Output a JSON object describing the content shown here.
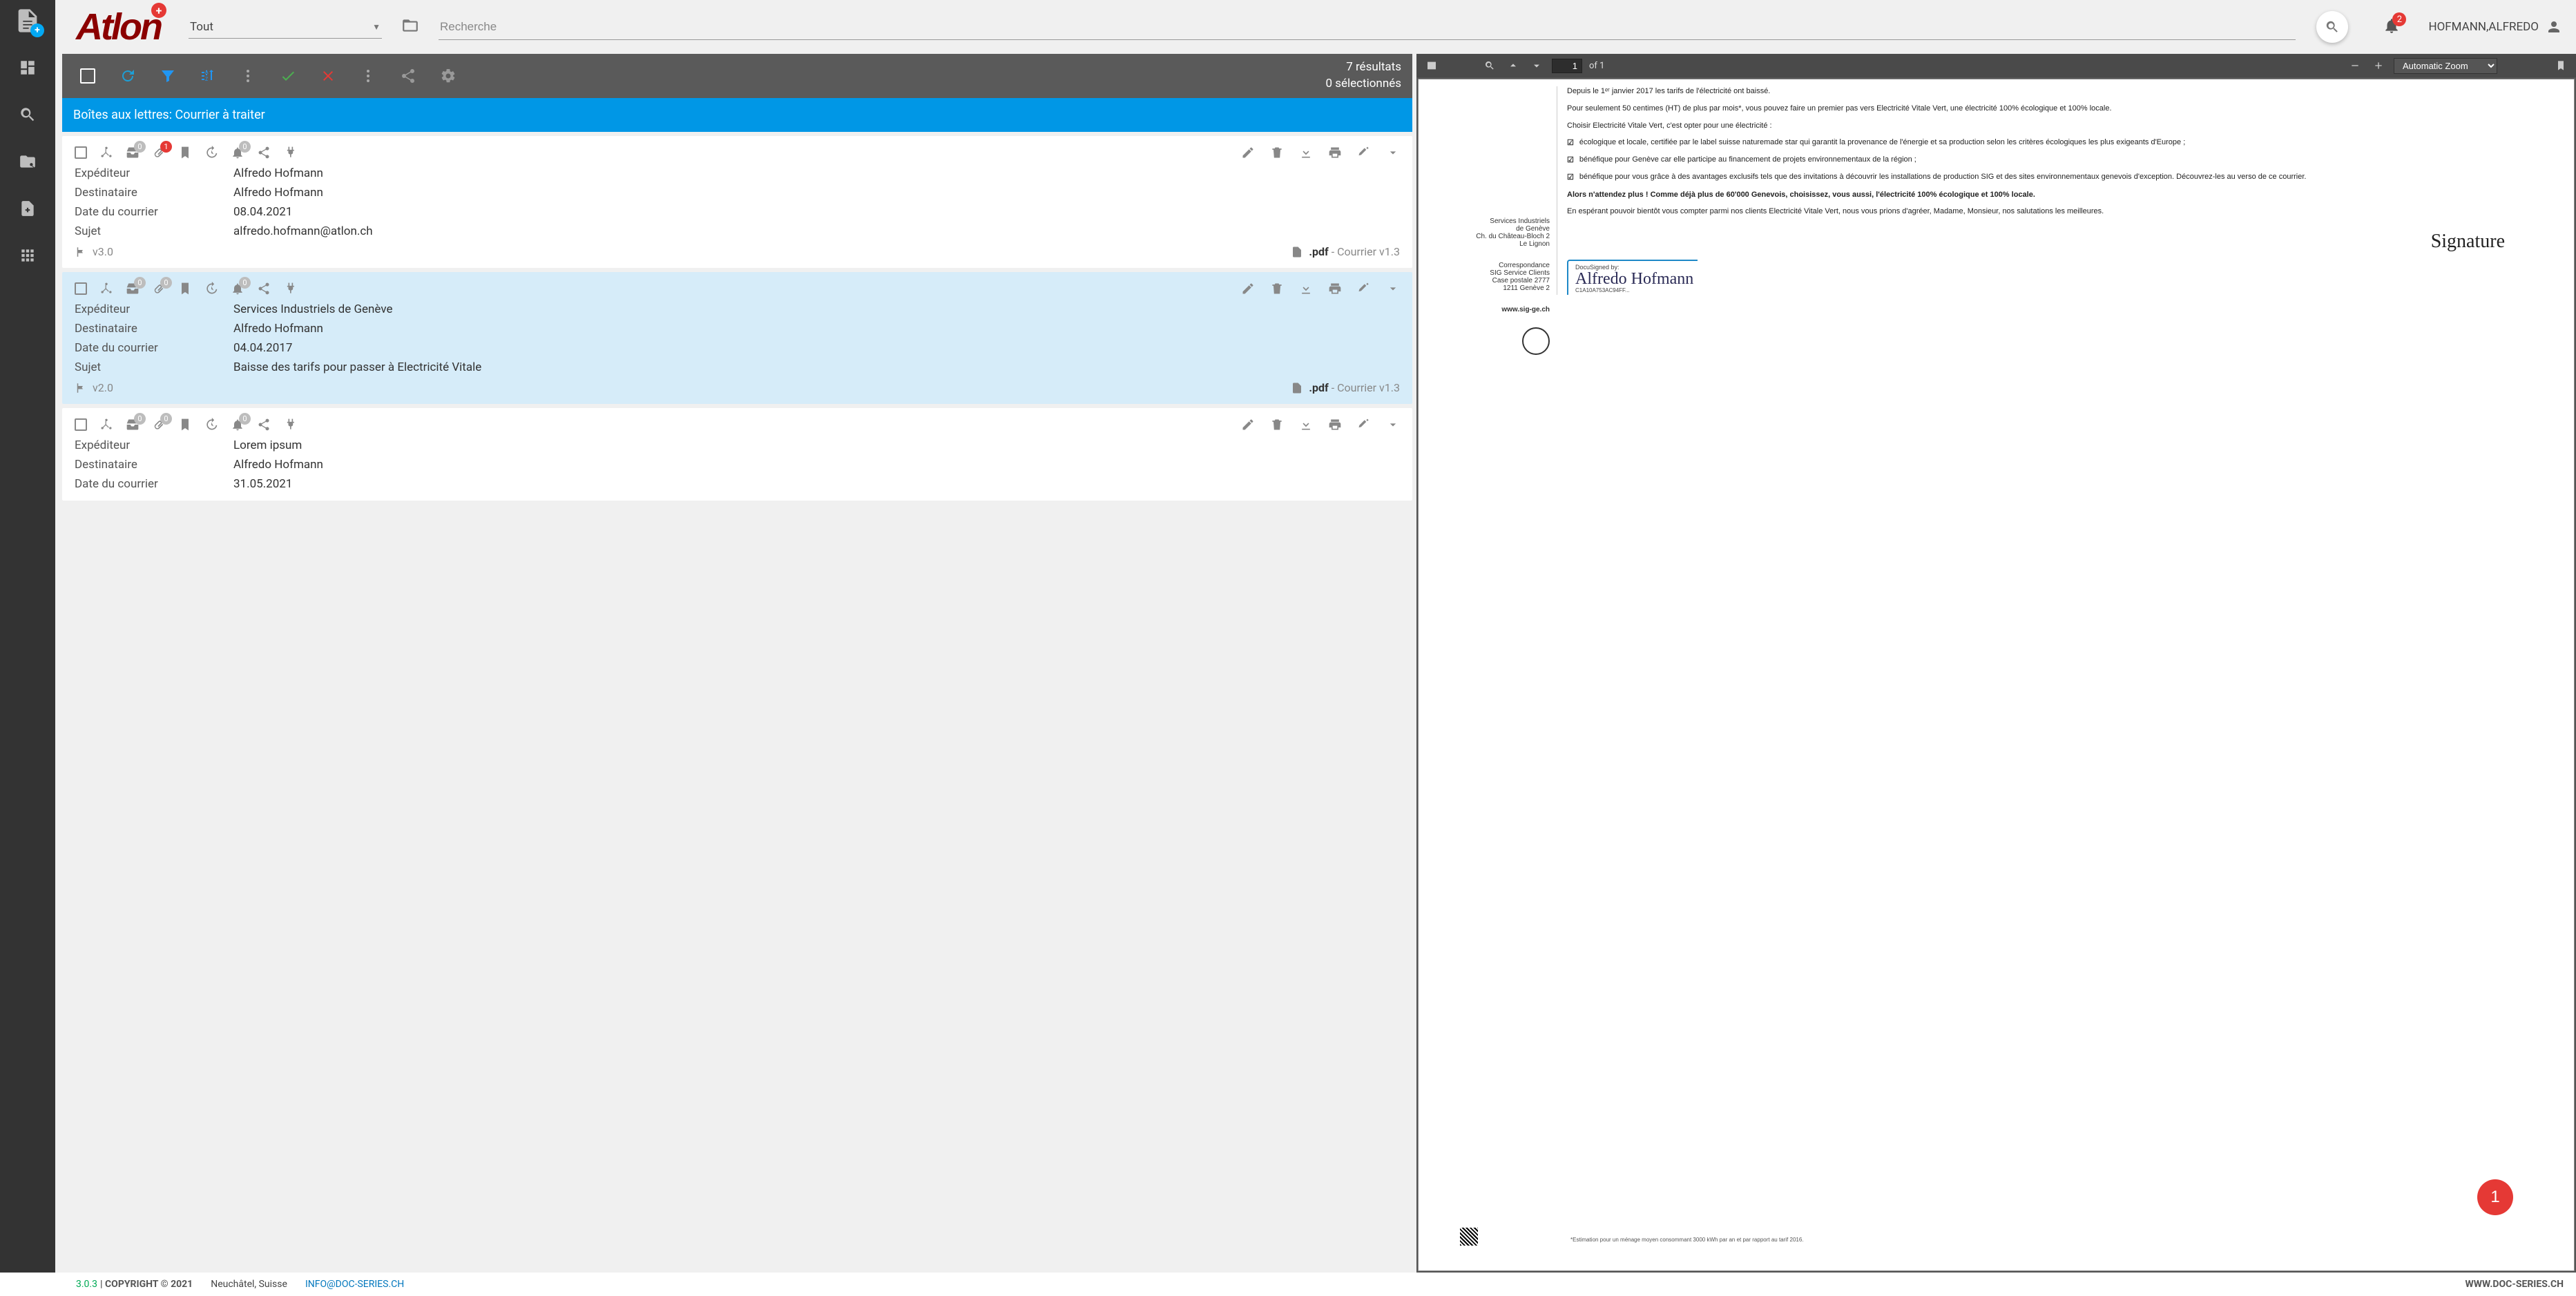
{
  "header": {
    "dropdown": "Tout",
    "search_placeholder": "Recherche",
    "notif_count": "2",
    "user": "HOFMANN,ALFREDO"
  },
  "toolbar": {
    "results": "7 résultats",
    "selected": "0 sélectionnés"
  },
  "list": {
    "breadcrumb": "Boîtes aux lettres: Courrier à traiter",
    "labels": {
      "expediteur": "Expéditeur",
      "destinataire": "Destinataire",
      "date": "Date du courrier",
      "sujet": "Sujet"
    },
    "cards": [
      {
        "b1": "0",
        "b2": "1",
        "b2red": true,
        "b4": "0",
        "expediteur": "Alfredo Hofmann",
        "destinataire": "Alfredo Hofmann",
        "date": "08.04.2021",
        "sujet": "alfredo.hofmann@atlon.ch",
        "version": "v3.0",
        "ext": ".pdf",
        "type": "- Courrier v1.3"
      },
      {
        "b1": "0",
        "b2": "0",
        "b2red": false,
        "b4": "0",
        "expediteur": "Services Industriels de Genève",
        "destinataire": "Alfredo Hofmann",
        "date": "04.04.2017",
        "sujet": "Baisse des tarifs pour passer à Electricité Vitale",
        "version": "v2.0",
        "ext": ".pdf",
        "type": "- Courrier v1.3",
        "selected": true
      },
      {
        "b1": "0",
        "b2": "0",
        "b2red": false,
        "b4": "0",
        "expediteur": "Lorem ipsum",
        "destinataire": "Alfredo Hofmann",
        "date": "31.05.2021",
        "sujet": "",
        "version": "",
        "ext": "",
        "type": ""
      }
    ]
  },
  "viewer": {
    "page": "1",
    "total": "of 1",
    "zoom": "Automatic Zoom",
    "left_col": {
      "b1": "Services Industriels\nde Genève\nCh. du Château-Bloch 2\nLe Lignon",
      "b2": "Correspondance\nSIG Service Clients\nCase postale 2777\n1211 Genève 2",
      "b3": "www.sig-ge.ch"
    },
    "body": {
      "intro1": "Depuis le 1ᵉʳ janvier 2017 les tarifs de l'électricité ont baissé.",
      "intro2": "Pour seulement 50 centimes (HT) de plus par mois*, vous pouvez faire un premier pas vers Electricité Vitale Vert, une électricité 100% écologique et 100% locale.",
      "choose": "Choisir Electricité Vitale Vert, c'est opter pour une électricité :",
      "c1": "écologique et locale, certifiée par le label suisse naturemade star qui garantit la provenance de l'énergie et sa production selon les critères écologiques les plus exigeants d'Europe ;",
      "c2": "bénéfique pour Genève car elle participe au financement de projets environnementaux de la région ;",
      "c3": "bénéfique pour vous grâce à des avantages exclusifs tels que des invitations à découvrir les installations de production SIG et des sites environnementaux genevois d'exception. Découvrez-les au verso de ce courrier.",
      "bold": "Alors n'attendez plus ! Comme déjà plus de 60'000 Genevois, choisissez, vous aussi, l'électricité 100% écologique et 100% locale.",
      "close": "En espérant pouvoir bientôt vous compter parmi nos clients Electricité Vitale Vert, nous vous prions d'agréer, Madame, Monsieur, nos salutations les meilleures.",
      "docu_label": "DocuSigned by:",
      "docu_name": "Alfredo Hofmann",
      "docu_id": "C1A10A753AC94FF...",
      "bubble": "1",
      "footnote": "*Estimation pour un ménage moyen consommant 3000 kWh par an et par rapport au tarif 2016."
    }
  },
  "footer": {
    "version": "3.0.3",
    "copyright": "| COPYRIGHT © 2021",
    "location": "Neuchâtel, Suisse",
    "email": "INFO@DOC-SERIES.CH",
    "site": "WWW.DOC-SERIES.CH"
  }
}
